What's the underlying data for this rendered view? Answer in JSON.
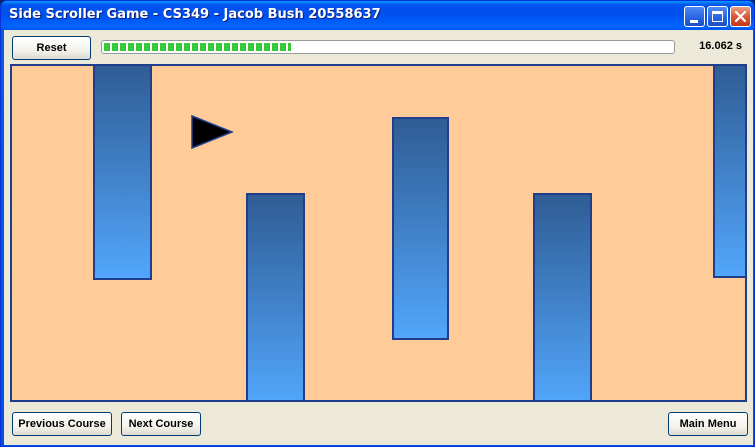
{
  "window": {
    "title": "Side Scroller Game - CS349 - Jacob Bush 20558637",
    "controls": [
      "minimize-icon",
      "maximize-icon",
      "close-icon"
    ]
  },
  "toolbar": {
    "reset_label": "Reset",
    "progress_fraction": 0.33,
    "timer": "16.062 s"
  },
  "footer": {
    "previous_label": "Previous Course",
    "next_label": "Next Course",
    "main_menu_label": "Main Menu"
  },
  "colors": {
    "game_background": "#ffcc99",
    "obstacle_top": "#2f5c94",
    "obstacle_bottom": "#52a6fb",
    "obstacle_border": "#1f3f8e",
    "player": "#000000",
    "progress": "#37c83a"
  },
  "icons": {
    "player": "triangle-right"
  }
}
